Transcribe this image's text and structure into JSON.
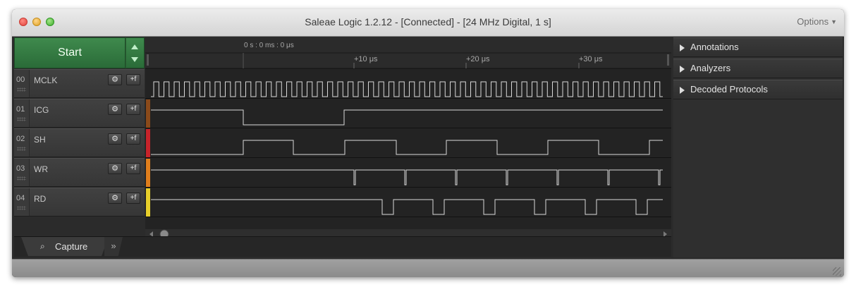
{
  "window": {
    "title": "Saleae Logic 1.2.12 - [Connected] - [24 MHz Digital, 1 s]",
    "options_label": "Options"
  },
  "controls": {
    "start_label": "Start"
  },
  "timeline": {
    "origin_label": "0 s : 0 ms : 0 μs",
    "ticks": [
      "+10 μs",
      "+20 μs",
      "+30 μs"
    ]
  },
  "channels": [
    {
      "num": "00",
      "name": "MCLK",
      "color": "#2a2a2a"
    },
    {
      "num": "01",
      "name": "ICG",
      "color": "#8b4a1a"
    },
    {
      "num": "02",
      "name": "SH",
      "color": "#c8232a"
    },
    {
      "num": "03",
      "name": "WR",
      "color": "#e07e1c"
    },
    {
      "num": "04",
      "name": "RD",
      "color": "#e8cf2a"
    }
  ],
  "capture_tab": {
    "label": "Capture",
    "icon": "search-icon",
    "more_icon": "chevron-double-right-icon"
  },
  "right_panel": {
    "items": [
      "Annotations",
      "Analyzers",
      "Decoded Protocols"
    ]
  },
  "colors": {
    "start_green": "#2f7a3e",
    "trace": "#d8d8d8"
  }
}
